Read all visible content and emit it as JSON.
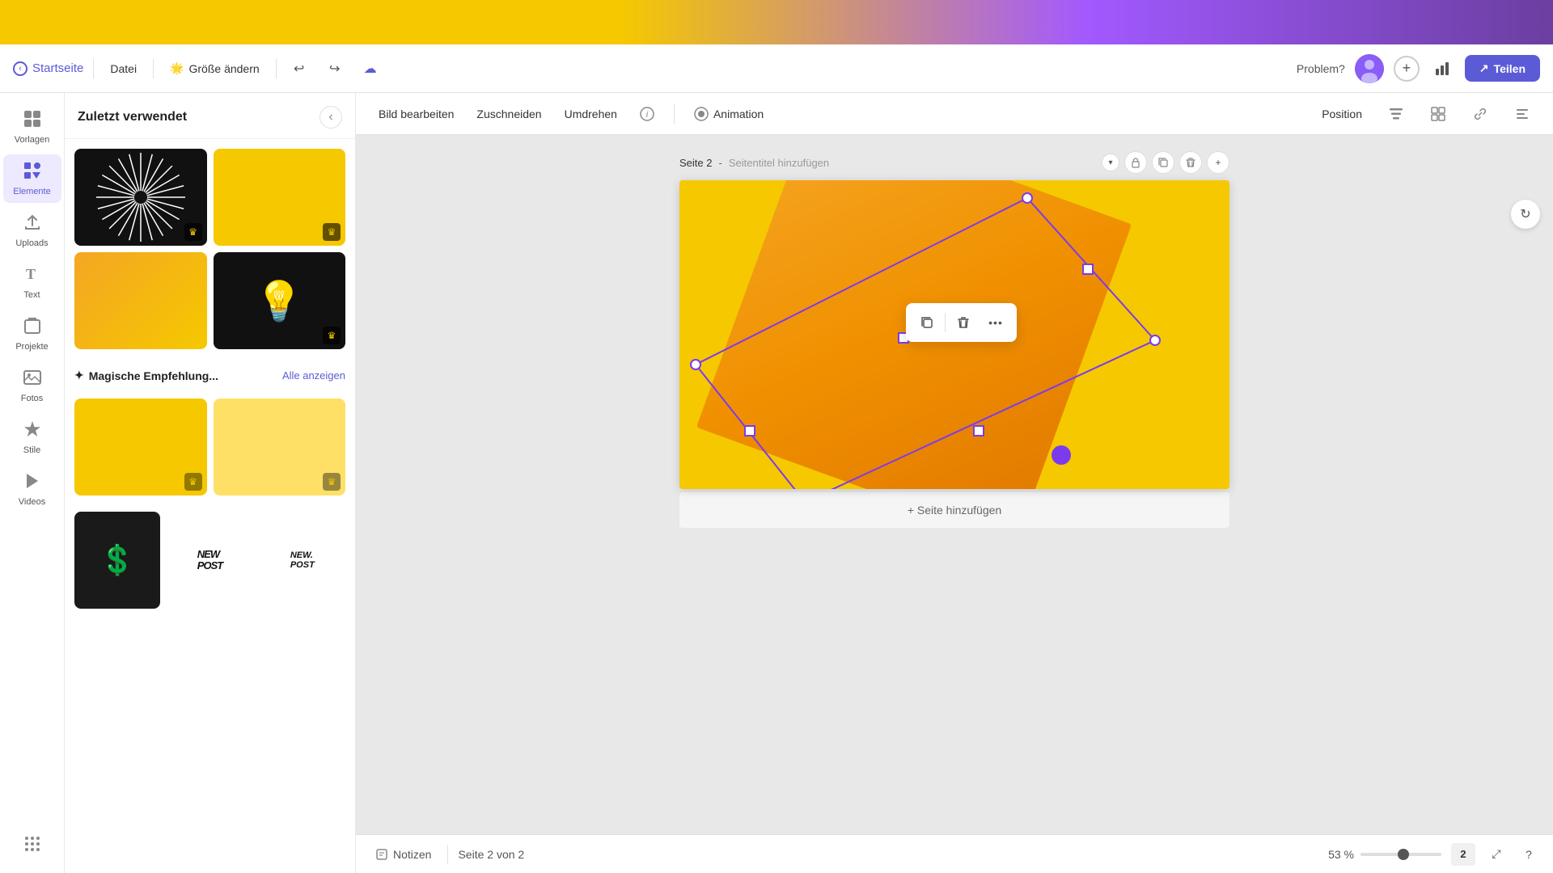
{
  "banner": {
    "visible": true
  },
  "header": {
    "home_label": "Startseite",
    "file_label": "Datei",
    "resize_label": "Größe ändern",
    "problem_label": "Problem?",
    "share_label": "Teilen"
  },
  "sidebar": {
    "items": [
      {
        "id": "vorlagen",
        "label": "Vorlagen",
        "icon": "⊞"
      },
      {
        "id": "elemente",
        "label": "Elemente",
        "icon": "✦"
      },
      {
        "id": "uploads",
        "label": "Uploads",
        "icon": "↑"
      },
      {
        "id": "text",
        "label": "Text",
        "icon": "T"
      },
      {
        "id": "projekte",
        "label": "Projekte",
        "icon": "□"
      },
      {
        "id": "fotos",
        "label": "Fotos",
        "icon": "⊞"
      },
      {
        "id": "stile",
        "label": "Stile",
        "icon": "⬡"
      },
      {
        "id": "videos",
        "label": "Videos",
        "icon": "▶"
      }
    ]
  },
  "panel": {
    "title": "Zuletzt verwendet",
    "magic_section": "Magische Empfehlung...",
    "all_show": "Alle anzeigen"
  },
  "toolbar": {
    "edit_image": "Bild bearbeiten",
    "crop": "Zuschneiden",
    "flip": "Umdrehen",
    "animation": "Animation",
    "position": "Position"
  },
  "canvas": {
    "page_label": "Seite 2",
    "page_subtitle": "Seitentitel hinzufügen",
    "add_page": "+ Seite hinzufügen"
  },
  "status_bar": {
    "notes": "Notizen",
    "page_indicator": "Seite 2 von 2",
    "zoom": "53 %"
  },
  "context_menu": {
    "copy_icon": "⧉",
    "delete_icon": "🗑",
    "more_icon": "···"
  }
}
